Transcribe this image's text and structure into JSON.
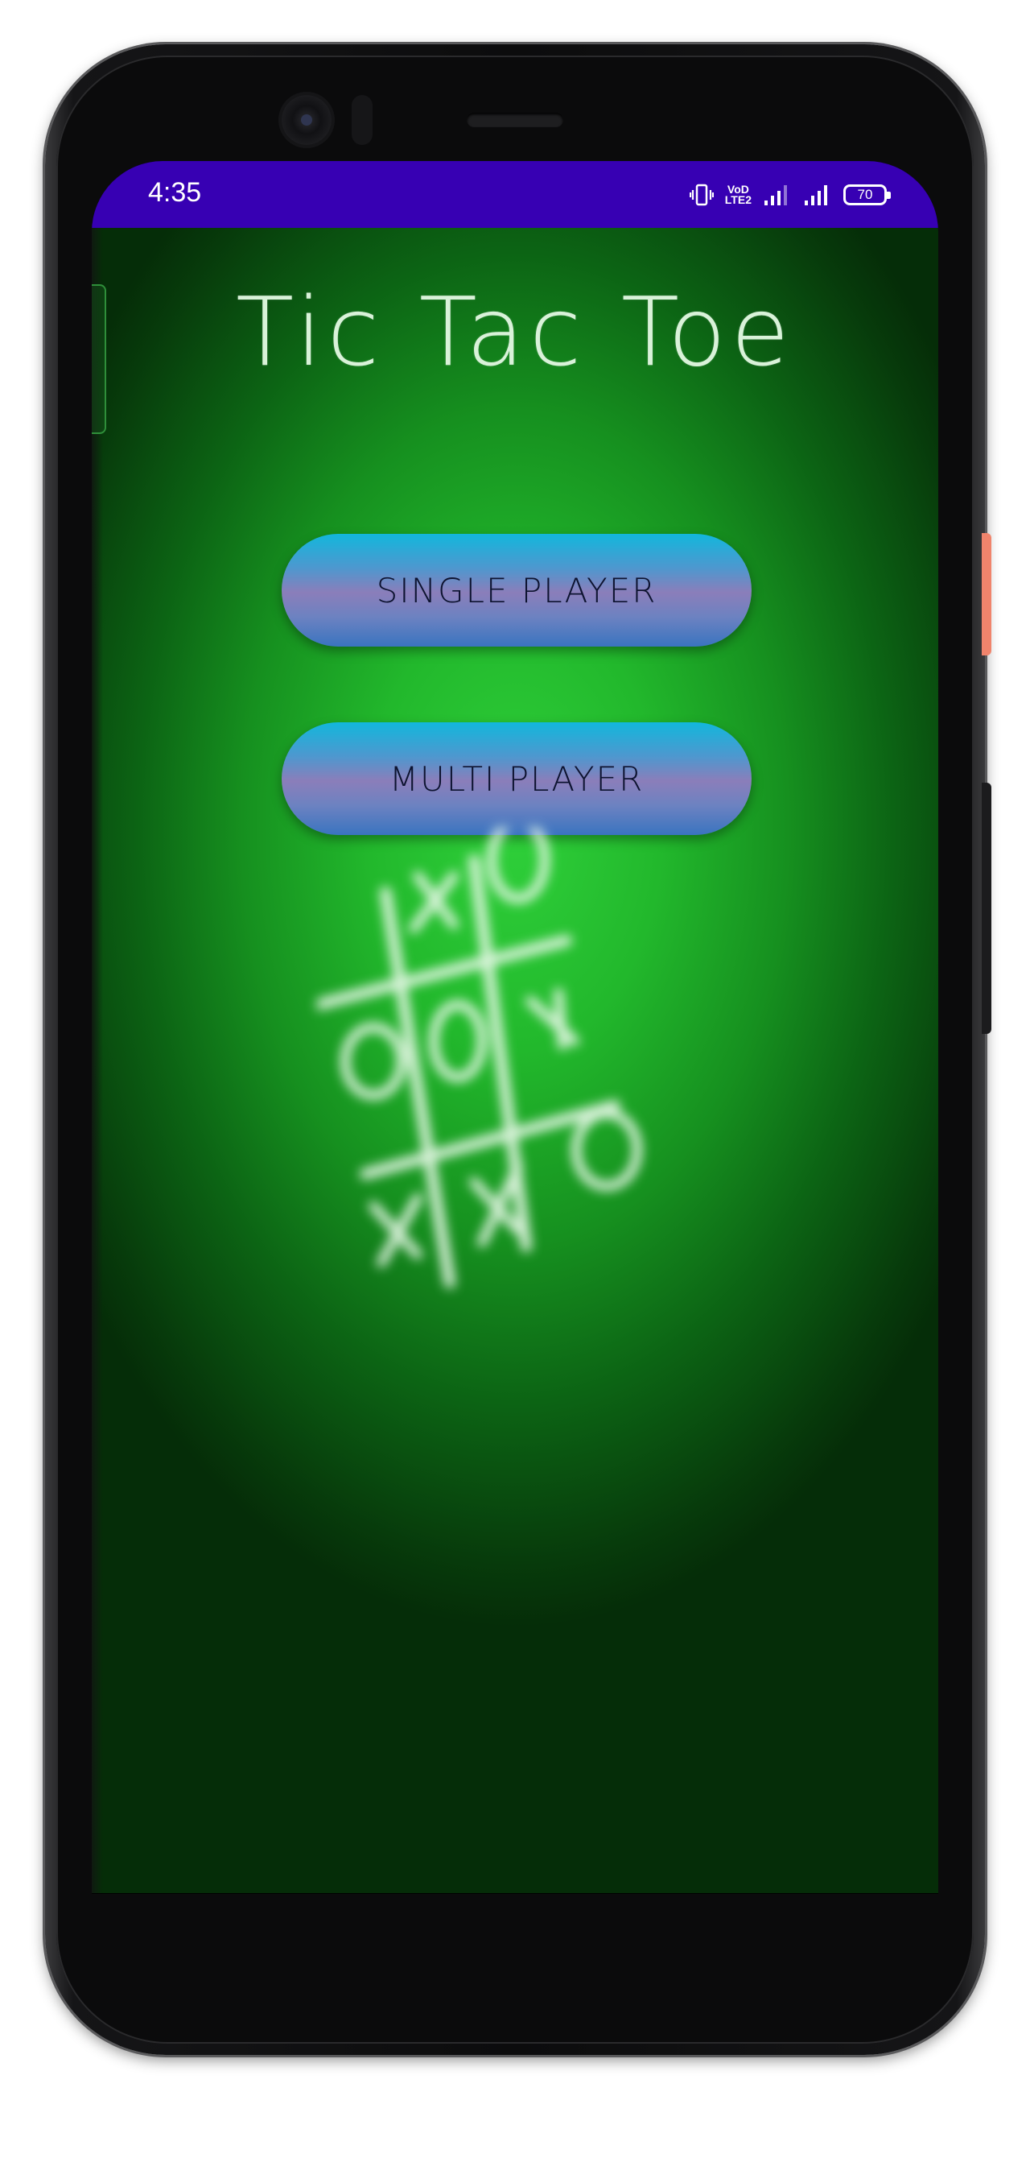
{
  "status_bar": {
    "time": "4:35",
    "battery_level": "70",
    "network_label_top": "VoD",
    "network_label_bottom": "LTE2",
    "icons": [
      "vibrate-icon",
      "volte-icon",
      "signal-icon",
      "signal-icon",
      "battery-icon"
    ],
    "background_color": "#3700b3"
  },
  "app": {
    "title": "Tic Tac Toe",
    "background_color": "#22b82c",
    "buttons": {
      "single_player": "SINGLE PLAYER",
      "multi_player": "MULTI PLAYER"
    },
    "board_art": {
      "cells": [
        "X",
        "O",
        "",
        "O",
        "O",
        "X",
        "X",
        "X",
        "O"
      ]
    }
  },
  "nav_bar": {
    "icons": [
      "recent-apps-icon",
      "home-icon",
      "back-icon"
    ]
  },
  "device": {
    "power_button_color": "#f0846c"
  }
}
